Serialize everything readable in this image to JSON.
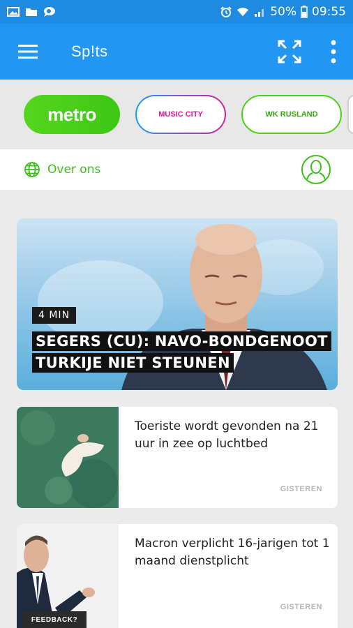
{
  "status_bar": {
    "battery": "50%",
    "time": "09:55",
    "icons": [
      "image-icon",
      "folder-icon",
      "search-chat-icon",
      "alarm-icon",
      "wifi-icon",
      "signal-icon",
      "battery-icon"
    ]
  },
  "app_bar": {
    "title": "Sp!ts",
    "icons": [
      "menu-icon",
      "expand-icon",
      "more-vert-icon"
    ],
    "color": "#2196f3"
  },
  "chips": [
    {
      "label": "metro"
    },
    {
      "label": "MUSIC CITY"
    },
    {
      "label": "WK RUSLAND"
    }
  ],
  "about": {
    "label": "Over ons",
    "accent": "#3dbf1a"
  },
  "hero": {
    "tag": "4 MIN",
    "headline_line1": "SEGERS (CU): NAVO-BONDGENOOT",
    "headline_line2": "TURKIJE NIET STEUNEN"
  },
  "articles": [
    {
      "title": "Toeriste wordt gevonden na 21 uur in zee op luchtbed",
      "time": "GISTEREN"
    },
    {
      "title": "Macron verplicht 16-jarigen tot 1 maand dienstplicht",
      "time": "GISTEREN"
    }
  ],
  "feedback": {
    "label": "FEEDBACK?"
  }
}
